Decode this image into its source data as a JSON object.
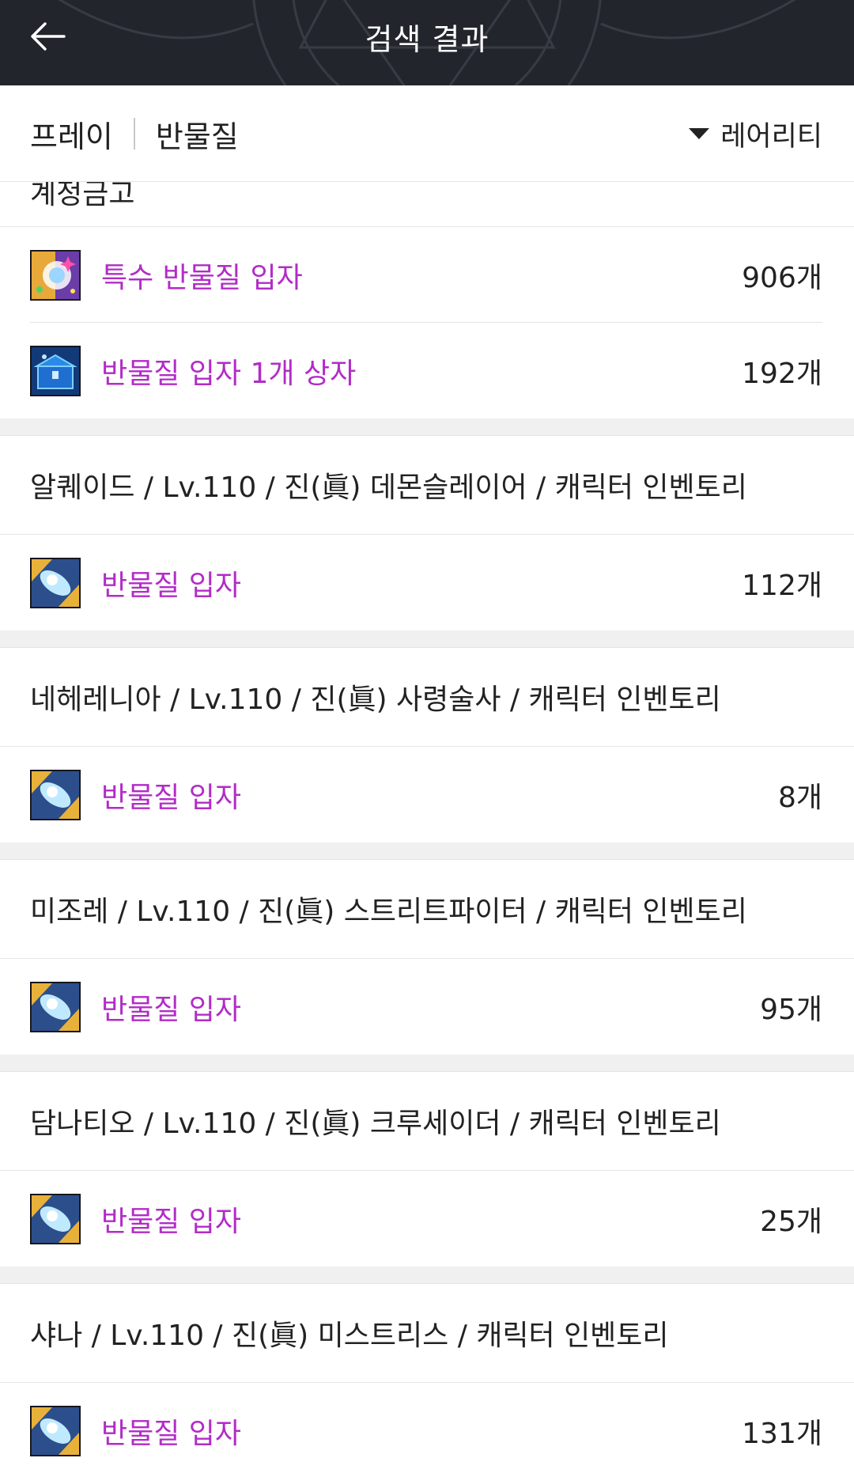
{
  "header": {
    "title": "검색 결과"
  },
  "filter": {
    "server": "프레이",
    "keyword": "반물질",
    "sort": "레어리티"
  },
  "partial_row": {
    "text": "계정금고"
  },
  "top_items": [
    {
      "name": "특수 반물질 입자",
      "count": "906개",
      "icon": "special-antimatter-particle-icon"
    },
    {
      "name": "반물질 입자 1개 상자",
      "count": "192개",
      "icon": "antimatter-particle-box-icon"
    }
  ],
  "groups": [
    {
      "header": "알퀘이드 / Lv.110 / 진(眞) 데몬슬레이어 / 캐릭터 인벤토리",
      "item": {
        "name": "반물질 입자",
        "count": "112개"
      }
    },
    {
      "header": "네헤레니아 / Lv.110 / 진(眞) 사령술사 / 캐릭터 인벤토리",
      "item": {
        "name": "반물질 입자",
        "count": "8개"
      }
    },
    {
      "header": "미조레 / Lv.110 / 진(眞) 스트리트파이터 / 캐릭터 인벤토리",
      "item": {
        "name": "반물질 입자",
        "count": "95개"
      }
    },
    {
      "header": "담나티오 / Lv.110 / 진(眞) 크루세이더 / 캐릭터 인벤토리",
      "item": {
        "name": "반물질 입자",
        "count": "25개"
      }
    },
    {
      "header": "샤나 / Lv.110 / 진(眞) 미스트리스 / 캐릭터 인벤토리",
      "item": {
        "name": "반물질 입자",
        "count": "131개"
      }
    }
  ],
  "colors": {
    "header_bg": "#22262c",
    "item_name": "#b22cc7",
    "gap": "#f0f0f0"
  }
}
